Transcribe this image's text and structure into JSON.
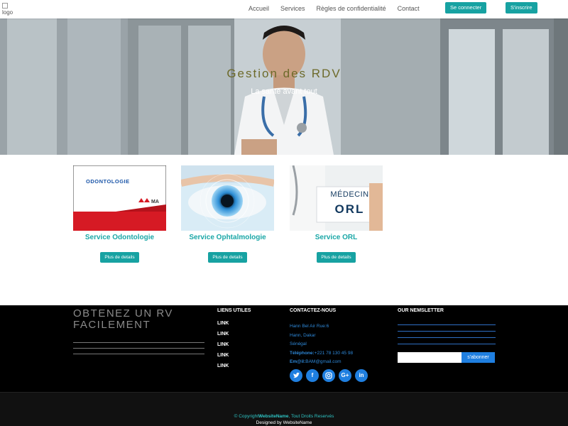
{
  "navbar": {
    "logo_alt": "logo",
    "links": [
      "Accueil",
      "Services",
      "Règles de confidentialité",
      "Contact"
    ],
    "login_button": "Se connecter",
    "signup_button": "S'inscrire"
  },
  "hero": {
    "title": "Gestion des RDV",
    "subtitle": "La santé avant tout"
  },
  "services": [
    {
      "image_text": "ODONTOLOGIE",
      "title": "Service Odontologie",
      "button": "Plus de details"
    },
    {
      "image_text": "",
      "title": "Service Ophtalmologie",
      "button": "Plus de details"
    },
    {
      "image_text_1": "MÉDECIN",
      "image_text_2": "ORL",
      "title": "Service ORL",
      "button": "Plus de details"
    }
  ],
  "footer": {
    "tagline": "OBTENEZ UN RV FACILEMENT",
    "useful_links_heading": "LIENS UTILES",
    "links": [
      "LINK",
      "LINK",
      "LINK",
      "LINK",
      "LINK"
    ],
    "contact_heading": "CONTACTEZ-NOUS",
    "address_line1": "Hann Bel Air Rue:6",
    "address_line2": "Hann, Dakar",
    "address_line3": "Sénégal",
    "phone_label": "Téléphone:",
    "phone": "+221 78 130 45 98",
    "email_label": "Em@il:",
    "email": "BAM@gmail.com",
    "newsletter_heading": "OUR NEMSLETTER",
    "newsletter_button": "s'abonner",
    "socials": [
      "twitter-icon",
      "facebook-icon",
      "instagram-icon",
      "google-plus-icon",
      "linkedin-icon"
    ]
  },
  "bottom": {
    "copyright_prefix": "© Copyright",
    "site_name": "WebsiteName",
    "copyright_suffix": ", Tout Droits Reservés",
    "designed_by": "Designed by WebsiteName"
  },
  "colors": {
    "accent": "#17a2a2",
    "social": "#1f7fe0",
    "footer_bg": "#000000"
  }
}
